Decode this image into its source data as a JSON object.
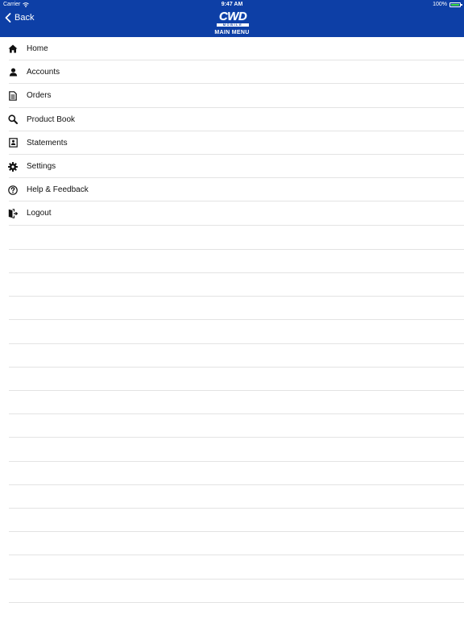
{
  "status_bar": {
    "carrier": "Carrier",
    "time": "9:47 AM",
    "battery_percent": "100%",
    "battery_level": 1.0
  },
  "nav": {
    "back_label": "Back",
    "logo_text": "CWD",
    "logo_subtext": "MOBILE",
    "title": "MAIN MENU"
  },
  "menu": {
    "items": [
      {
        "label": "Home",
        "icon": "home-icon"
      },
      {
        "label": "Accounts",
        "icon": "person-icon"
      },
      {
        "label": "Orders",
        "icon": "document-icon"
      },
      {
        "label": "Product Book",
        "icon": "search-icon"
      },
      {
        "label": "Statements",
        "icon": "statement-icon"
      },
      {
        "label": "Settings",
        "icon": "gear-icon"
      },
      {
        "label": "Help & Feedback",
        "icon": "help-icon"
      },
      {
        "label": "Logout",
        "icon": "logout-icon"
      }
    ]
  },
  "colors": {
    "nav_background": "#0d3fa6",
    "battery_fill": "#3ddc3d",
    "separator": "#e3e3e3"
  }
}
